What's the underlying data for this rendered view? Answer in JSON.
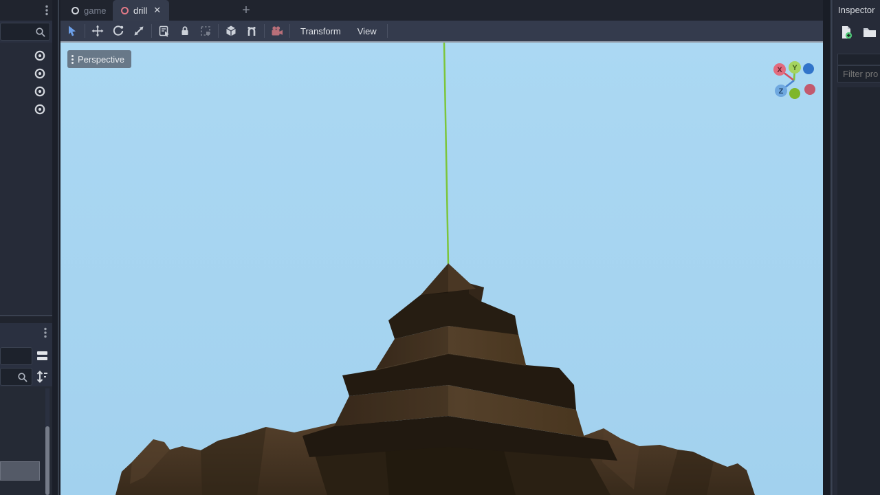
{
  "tabs": {
    "scene": [
      {
        "label": "game",
        "state": "inactive"
      },
      {
        "label": "drill",
        "state": "active"
      }
    ],
    "close_glyph": "✕",
    "new_tab_glyph": "+"
  },
  "toolbar": {
    "menus": {
      "transform": "Transform",
      "view": "View"
    },
    "tools": [
      "select",
      "move",
      "rotate",
      "scale",
      "list-select",
      "lock",
      "group",
      "local-space",
      "snap",
      "camera-preview"
    ]
  },
  "viewport": {
    "projection": "Perspective",
    "gizmo_labels": {
      "x": "X",
      "y": "Y",
      "z": "Z"
    }
  },
  "inspector": {
    "title": "Inspector",
    "filter_placeholder": "Filter pro"
  },
  "left_dock": {
    "visibility_toggle_count": 4
  },
  "colors": {
    "sky": "#a7d5f1",
    "select_tool_blue": "#6c9fe8",
    "axis_x_red": "#e26b7e",
    "axis_y_green": "#9fd24a",
    "axis_z_blue": "#5c93d6",
    "negative_x_red": "#c25a6e",
    "negative_y_green": "#7fb62b",
    "negative_z_blue": "#3174ca",
    "camera_preview_pink": "#b96f79",
    "active_tab_accent_pink": "#e27a87",
    "selection_line_green": "#7cc53b",
    "drill_brown_dark": "#261d12",
    "drill_brown_mid": "#4e3a27",
    "toolbar_bg": "#343b4d",
    "panel_bg": "#262b38"
  }
}
